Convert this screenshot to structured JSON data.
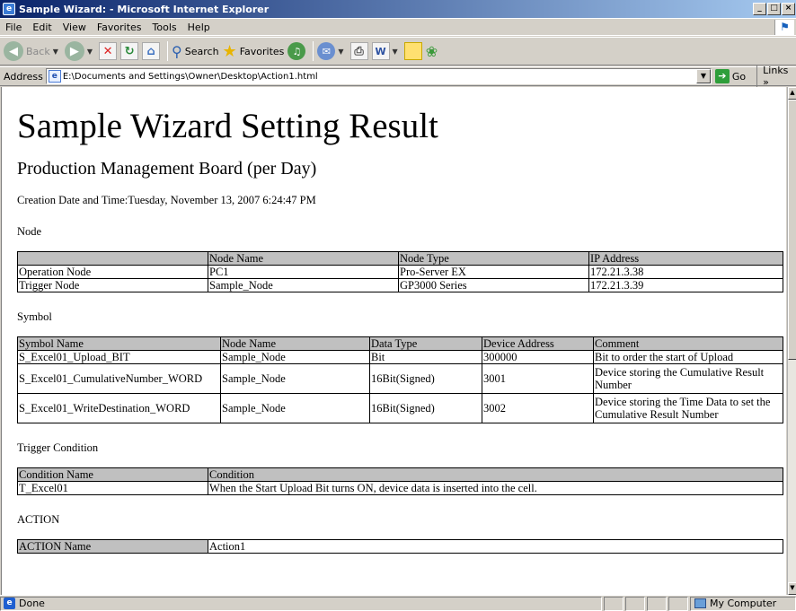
{
  "window": {
    "title": "Sample Wizard: - Microsoft Internet Explorer",
    "controls": {
      "minimize": "_",
      "maximize": "□",
      "close": "×"
    }
  },
  "menu": [
    "File",
    "Edit",
    "View",
    "Favorites",
    "Tools",
    "Help"
  ],
  "toolbar": {
    "back_label": "Back",
    "search_label": "Search",
    "favorites_label": "Favorites"
  },
  "address": {
    "label": "Address",
    "url": "E:\\Documents and Settings\\Owner\\Desktop\\Action1.html",
    "go_label": "Go",
    "links_label": "Links »"
  },
  "page": {
    "title": "Sample Wizard Setting Result",
    "subtitle": "Production Management Board (per Day)",
    "creation": "Creation Date and Time:Tuesday, November 13, 2007 6:24:47 PM",
    "node_section": {
      "label": "Node",
      "headers": [
        "",
        "Node Name",
        "Node Type",
        "IP Address"
      ],
      "rows": [
        [
          "Operation Node",
          "PC1",
          "Pro-Server EX",
          "172.21.3.38"
        ],
        [
          "Trigger Node",
          "Sample_Node",
          "GP3000 Series",
          "172.21.3.39"
        ]
      ]
    },
    "symbol_section": {
      "label": "Symbol",
      "headers": [
        "Symbol Name",
        "Node Name",
        "Data Type",
        "Device Address",
        "Comment"
      ],
      "rows": [
        [
          "S_Excel01_Upload_BIT",
          "Sample_Node",
          "Bit",
          "300000",
          "Bit to order the start of Upload"
        ],
        [
          "S_Excel01_CumulativeNumber_WORD",
          "Sample_Node",
          "16Bit(Signed)",
          "3001",
          "Device storing the Cumulative Result Number"
        ],
        [
          "S_Excel01_WriteDestination_WORD",
          "Sample_Node",
          "16Bit(Signed)",
          "3002",
          "Device storing the Time Data to set the Cumulative Result Number"
        ]
      ]
    },
    "trigger_section": {
      "label": "Trigger Condition",
      "headers": [
        "Condition Name",
        "Condition"
      ],
      "rows": [
        [
          "T_Excel01",
          "When the Start Upload Bit turns ON, device data is inserted into the cell."
        ]
      ]
    },
    "action_section": {
      "label": "ACTION",
      "rows": [
        [
          "ACTION Name",
          "Action1"
        ]
      ]
    }
  },
  "status": {
    "text": "Done",
    "zone": "My Computer"
  }
}
